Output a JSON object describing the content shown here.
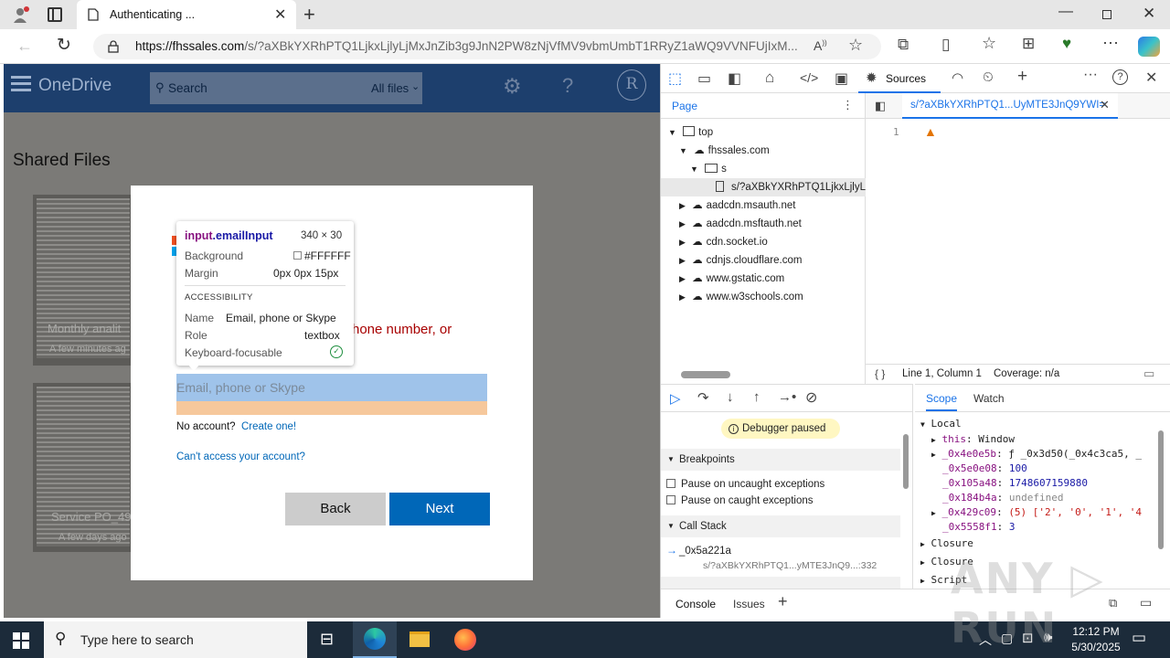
{
  "browser": {
    "tab_title": "Authenticating ...",
    "url_host": "https://fhssales.com",
    "url_path": "/s/?aXBkYXRhPTQ1LjkxLjlyLjMxJnZib3g9JnN2PW8zNjVfMV9vbmUmbT1RRyZ1aWQ9VVNFUjIxM..."
  },
  "onedrive": {
    "brand": "OneDrive",
    "search_placeholder": "Search",
    "search_scope": "All files",
    "avatar_letter": "R",
    "section_title": "Shared Files",
    "files": [
      {
        "name": "Monthly analit",
        "meta": "A few minutes ag"
      },
      {
        "name": "Service PO_49",
        "meta": "A few days ago"
      }
    ]
  },
  "signin": {
    "error_text": "hone number, or",
    "email_placeholder": "Email, phone or Skype",
    "no_account": "No account?",
    "create_link": "Create one!",
    "cant_access": "Can't access your account?",
    "back_label": "Back",
    "next_label": "Next"
  },
  "inspect_tooltip": {
    "selector_tag": "input",
    "selector_class": ".emailInput",
    "size": "340 × 30",
    "bg_label": "Background",
    "bg_value": "#FFFFFF",
    "margin_label": "Margin",
    "margin_value": "0px 0px 15px",
    "a11y_header": "ACCESSIBILITY",
    "name_label": "Name",
    "name_value": "Email, phone or Skype",
    "role_label": "Role",
    "role_value": "textbox",
    "kbd_label": "Keyboard-focusable"
  },
  "devtools": {
    "sources_tab": "Sources",
    "page_tab": "Page",
    "file_tab": "s/?aXBkYXRhPTQ1...UyMTE3JnQ9YWI=",
    "tree": {
      "top": "top",
      "host": "fhssales.com",
      "folder": "s",
      "file": "s/?aXBkYXRhPTQ1LjkxLjlyL",
      "domains": [
        "aadcdn.msauth.net",
        "aadcdn.msftauth.net",
        "cdn.socket.io",
        "cdnjs.cloudflare.com",
        "www.gstatic.com",
        "www.w3schools.com"
      ]
    },
    "line_number": "1",
    "cursor_pos": "Line 1, Column 1",
    "coverage": "Coverage: n/a",
    "paused_label": "Debugger paused",
    "breakpoints_header": "Breakpoints",
    "pause_uncaught": "Pause on uncaught exceptions",
    "pause_caught": "Pause on caught exceptions",
    "callstack_header": "Call Stack",
    "callstack_fn": "_0x5a221a",
    "callstack_loc": "s/?aXBkYXRhPTQ1...yMTE3JnQ9...:332",
    "scope_tab": "Scope",
    "watch_tab": "Watch",
    "scope": {
      "local": "Local",
      "rows": [
        {
          "k": "this",
          "v": "Window"
        },
        {
          "k": "_0x4e0e5b",
          "v": "ƒ _0x3d50(_0x4c3ca5, _"
        },
        {
          "k": "_0x5e0e08",
          "v": "100"
        },
        {
          "k": "_0x105a48",
          "v": "1748607159880"
        },
        {
          "k": "_0x184b4a",
          "v": "undefined"
        },
        {
          "k": "_0x429c09",
          "v": "(5) ['2', '0', '1', '4"
        },
        {
          "k": "_0x5558f1",
          "v": "3"
        }
      ],
      "closure1": "Closure",
      "closure2": "Closure",
      "script": "Script"
    },
    "console_tab": "Console",
    "issues_tab": "Issues"
  },
  "taskbar": {
    "search_placeholder": "Type here to search",
    "time": "12:12 PM",
    "date": "5/30/2025"
  },
  "colors": {
    "od_header": "#1d3f6d",
    "ms_blue": "#0067b8",
    "error_red": "#a80000",
    "devtools_blue": "#1a73e8"
  }
}
